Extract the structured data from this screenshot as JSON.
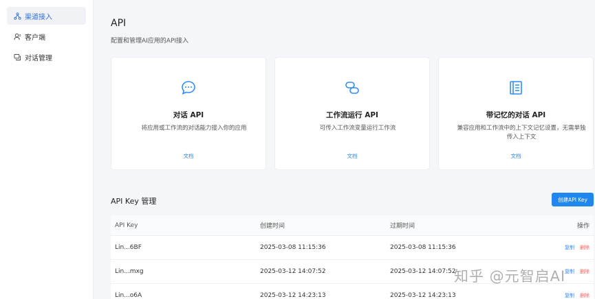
{
  "sidebar": {
    "items": [
      {
        "label": "渠道接入",
        "icon": "channel-icon",
        "active": true
      },
      {
        "label": "客户端",
        "icon": "user-icon",
        "active": false
      },
      {
        "label": "对话管理",
        "icon": "chat-icon",
        "active": false
      }
    ]
  },
  "header": {
    "title": "API",
    "subtitle": "配置和管理AI应用的API接入"
  },
  "cards": [
    {
      "icon": "chat-bubble-icon",
      "title": "对话 API",
      "description": "将应用或工作流的对话能力接入你的应用",
      "doc_label": "文档"
    },
    {
      "icon": "workflow-icon",
      "title": "工作流运行 API",
      "description": "可传入工作流变量运行工作流",
      "doc_label": "文档"
    },
    {
      "icon": "memory-book-icon",
      "title": "带记忆的对话 API",
      "description": "兼容应用和工作流中的上下文记忆设置，无需单独传入上下文",
      "doc_label": "文档"
    }
  ],
  "api_keys": {
    "section_title": "API Key 管理",
    "create_label": "创建API Key",
    "columns": [
      "API Key",
      "创建时间",
      "过期时间",
      "操作"
    ],
    "rows": [
      {
        "key": "Lin...6BF",
        "created": "2025-03-08 11:15:36",
        "expires": "2025-03-08 11:15:36",
        "copy": "复制",
        "delete": "删除"
      },
      {
        "key": "Lin...mxg",
        "created": "2025-03-12 14:07:52",
        "expires": "2025-03-12 14:07:52",
        "copy": "复制",
        "delete": "删除"
      },
      {
        "key": "Lin...o6A",
        "created": "2025-03-12 14:23:13",
        "expires": "2025-03-12 14:23:13",
        "copy": "复制",
        "delete": "删除"
      }
    ]
  },
  "watermark": "知乎 @元智启AI",
  "colors": {
    "accent": "#1e88f0",
    "delete": "#f5605a",
    "link": "#2f8bff"
  }
}
